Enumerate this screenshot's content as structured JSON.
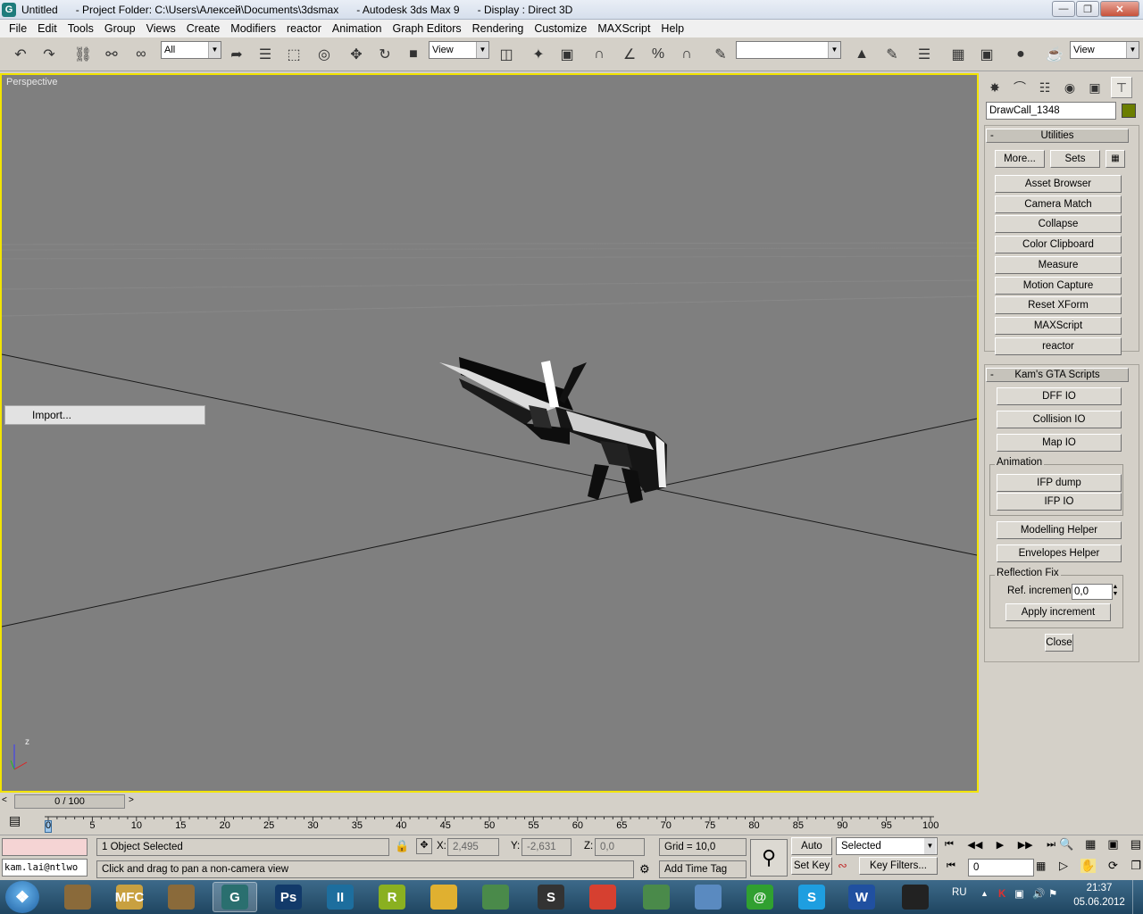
{
  "window": {
    "title": "Untitled      - Project Folder: C:\\Users\\Алексей\\Documents\\3dsmax      - Autodesk 3ds Max 9      - Display : Direct 3D",
    "app_icon": "3dsmax-icon",
    "controls": [
      "minimize",
      "maximize",
      "close"
    ]
  },
  "menu": [
    "File",
    "Edit",
    "Tools",
    "Group",
    "Views",
    "Create",
    "Modifiers",
    "reactor",
    "Animation",
    "Graph Editors",
    "Rendering",
    "Customize",
    "MAXScript",
    "Help"
  ],
  "toolbar": {
    "selection_filter": "All",
    "ref_coord": "View",
    "named_selection": "",
    "right_view": "View"
  },
  "viewport": {
    "label": "Perspective",
    "context_menu_item": "Import...",
    "gizmo_axis": "z",
    "border_color": "#f2e400",
    "background": "#7f7f7f"
  },
  "command_panel": {
    "object_name": "DrawCall_1348",
    "object_color": "#6b7e00",
    "utilities": {
      "title": "Utilities",
      "more_label": "More...",
      "sets_label": "Sets",
      "buttons": [
        "Asset Browser",
        "Camera Match",
        "Collapse",
        "Color Clipboard",
        "Measure",
        "Motion Capture",
        "Reset XForm",
        "MAXScript",
        "reactor"
      ]
    },
    "gta": {
      "title": "Kam's GTA Scripts",
      "buttons": [
        "DFF IO",
        "Collision IO",
        "Map IO"
      ],
      "animation_group": "Animation",
      "animation_buttons": [
        "IFP dump",
        "IFP IO"
      ],
      "helpers": [
        "Modelling Helper",
        "Envelopes Helper"
      ],
      "reflection_group": "Reflection Fix",
      "ref_increment_label": "Ref. increment",
      "ref_increment_value": "0,0",
      "apply_label": "Apply increment",
      "close_label": "Close"
    }
  },
  "timeline": {
    "slider_text": "0 / 100",
    "ticks": [
      "0",
      "5",
      "10",
      "15",
      "20",
      "25",
      "30",
      "35",
      "40",
      "45",
      "50",
      "55",
      "60",
      "65",
      "70",
      "75",
      "80",
      "85",
      "90",
      "95",
      "100"
    ]
  },
  "status": {
    "maxscript_listener": "kam.lai@ntlwo",
    "selection": "1 Object Selected",
    "prompt": "Click and drag to pan a non-camera view",
    "x_label": "X:",
    "x_value": "2,495",
    "y_label": "Y:",
    "y_value": "-2,631",
    "z_label": "Z:",
    "z_value": "0,0",
    "grid": "Grid = 10,0",
    "add_time_tag": "Add Time Tag",
    "auto_key": "Auto Key",
    "set_key": "Set Key",
    "key_mode": "Selected",
    "key_filters": "Key Filters...",
    "frame": "0"
  },
  "taskbar": {
    "lang": "RU",
    "time": "21:37",
    "date": "05.06.2012",
    "apps": [
      {
        "name": "gta-sa-icon",
        "label": "",
        "color": "#8a6a3a"
      },
      {
        "name": "mfc-icon",
        "label": "MFC",
        "color": "#c8a040"
      },
      {
        "name": "gta-sa-icon",
        "label": "",
        "color": "#8a6a3a"
      },
      {
        "name": "3dsmax-icon",
        "label": "G",
        "color": "#2a6f6f"
      },
      {
        "name": "photoshop-icon",
        "label": "Ps",
        "color": "#123a6a"
      },
      {
        "name": "tool-icon",
        "label": "II",
        "color": "#1d6e9e"
      },
      {
        "name": "rockstar-icon",
        "label": "R",
        "color": "#8ab020"
      },
      {
        "name": "folder-icon",
        "label": "",
        "color": "#e0b030"
      },
      {
        "name": "window-icon",
        "label": "",
        "color": "#4a8a4a"
      },
      {
        "name": "steam-icon",
        "label": "S",
        "color": "#333333"
      },
      {
        "name": "chrome-icon",
        "label": "",
        "color": "#d64030"
      },
      {
        "name": "window-icon",
        "label": "",
        "color": "#4a8a4a"
      },
      {
        "name": "stack-icon",
        "label": "",
        "color": "#5a8ac0"
      },
      {
        "name": "mail-agent-icon",
        "label": "@",
        "color": "#30a030"
      },
      {
        "name": "skype-icon",
        "label": "S",
        "color": "#1e9ee0"
      },
      {
        "name": "word-icon",
        "label": "W",
        "color": "#2050a0"
      },
      {
        "name": "skull-icon",
        "label": "",
        "color": "#222222"
      }
    ]
  }
}
